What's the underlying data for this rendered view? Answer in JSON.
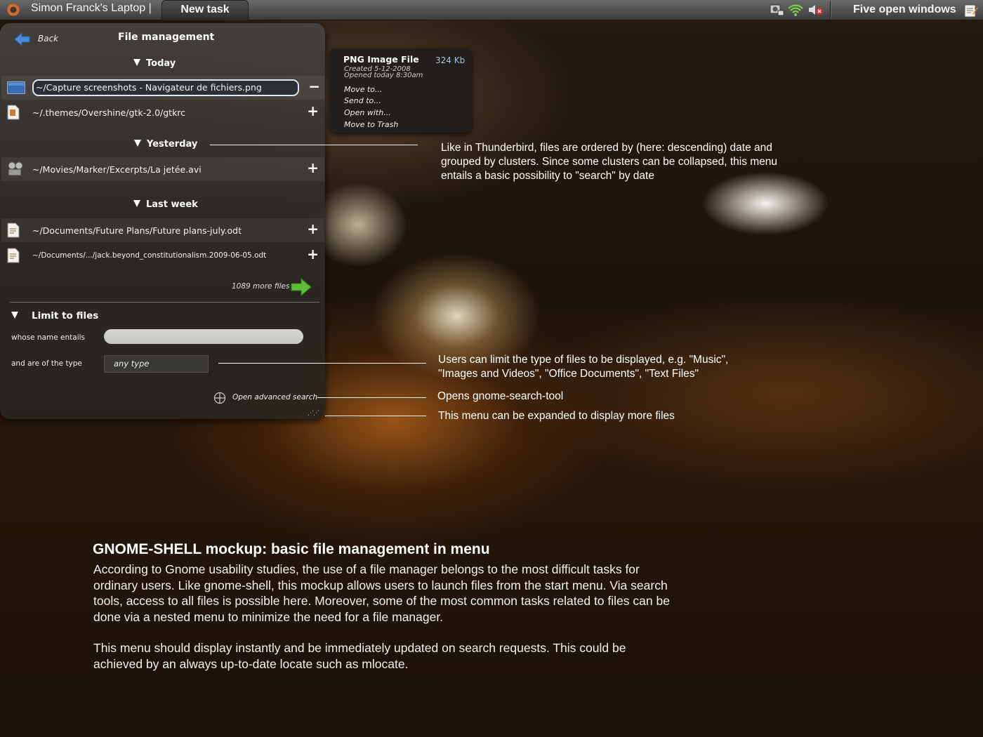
{
  "topbar": {
    "host": "Simon Franck's Laptop  |",
    "new_task": "New task",
    "windows": "Five open windows"
  },
  "menu": {
    "back": "Back",
    "title": "File management",
    "groups": [
      {
        "label": "Today",
        "rows": [
          {
            "path": "~/Capture screenshots  - Navigateur de fichiers.png",
            "action": "−",
            "icon": "image-file-icon",
            "selected": true
          },
          {
            "path": "~/.themes/Overshine/gtk-2.0/gtkrc",
            "action": "+",
            "icon": "text-file-icon"
          }
        ]
      },
      {
        "label": "Yesterday",
        "rows": [
          {
            "path": "~/Movies/Marker/Excerpts/La jetée.avi",
            "action": "+",
            "icon": "video-file-icon"
          }
        ]
      },
      {
        "label": "Last week",
        "rows": [
          {
            "path": "~/Documents/Future Plans/Future plans-july.odt",
            "action": "+",
            "icon": "document-file-icon"
          },
          {
            "path": "~/Documents/.../jack.beyond_constitutionalism.2009-06-05.odt",
            "action": "+",
            "icon": "document-file-icon"
          }
        ]
      }
    ],
    "more_files": "1089 more files",
    "limit": {
      "title": "Limit to files",
      "whose": "whose   name entails",
      "name_value": "",
      "type_label": "and are of the type",
      "type_value": "any type",
      "advanced": "Open advanced search"
    }
  },
  "popup": {
    "title": "PNG Image File",
    "size": "324 Kb",
    "created": "Created 5-12-2008",
    "opened": "Opened today 8:30am",
    "items": [
      "Move to...",
      "Send to...",
      "Open with...",
      "Move to Trash"
    ]
  },
  "notes": {
    "clusters": "Like in Thunderbird, files are ordered by (here: descending) date and grouped by clusters. Since some clusters can be collapsed, this menu entails a basic possibility to \"search\" by date",
    "types": "Users can limit the type of files to be displayed, e.g. \"Music\", \"Images and Videos\", \"Office Documents\", \"Text Files\"",
    "advanced": "Opens gnome-search-tool",
    "expand": "This menu can be expanded to display more files"
  },
  "description": {
    "title": "GNOME-SHELL mockup: basic file management in menu",
    "para1": "According to Gnome usability studies, the use of a file manager belongs to the most difficult tasks for ordinary users. Like gnome-shell, this mockup allows users to launch files from the start menu. Via search tools, access to all files is possible here. Moreover, some of the most common tasks related to files can be done via a nested menu to minimize the need for a file manager.",
    "para2": "This menu should display instantly and be immediately updated on search requests. This could be achieved by an always up-to-date locate such as mlocate."
  }
}
